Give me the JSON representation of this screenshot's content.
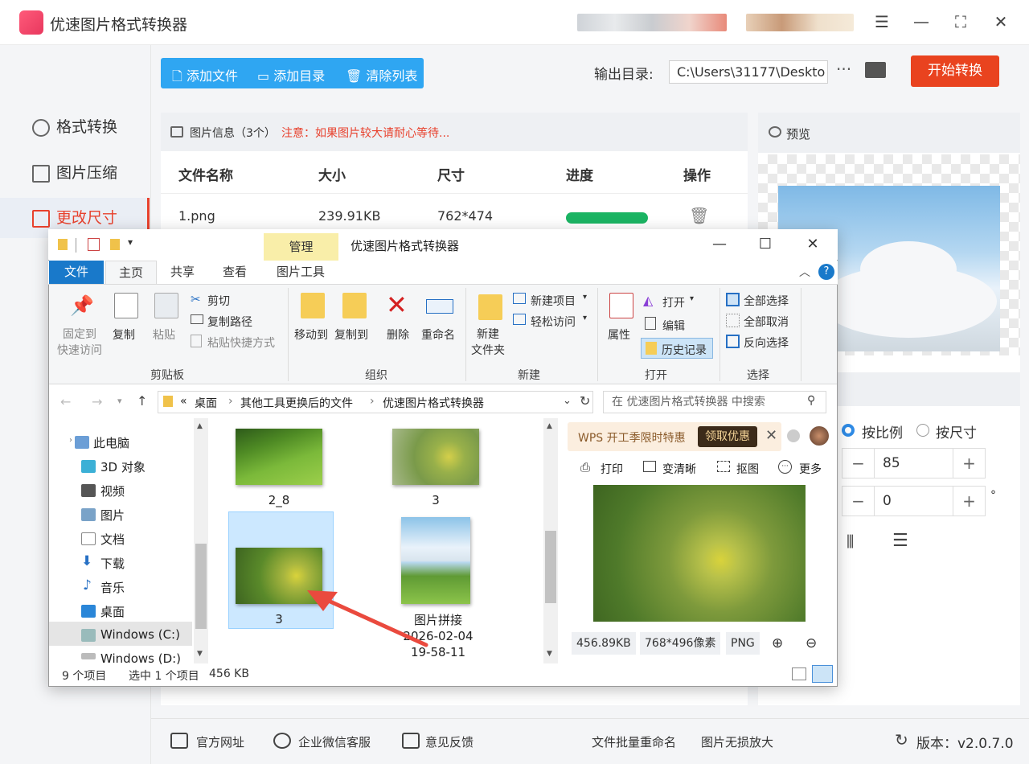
{
  "app": {
    "title": "优速图片格式转换器"
  },
  "sidebar": {
    "items": [
      {
        "label": "格式转换"
      },
      {
        "label": "图片压缩"
      },
      {
        "label": "更改尺寸"
      }
    ]
  },
  "toolbar": {
    "add_file": "添加文件",
    "add_dir": "添加目录",
    "clear_list": "清除列表"
  },
  "output": {
    "label": "输出目录:",
    "path": "C:\\Users\\31177\\Deskto",
    "more": "···",
    "start_button": "开始转换"
  },
  "info": {
    "title": "图片信息（3个）",
    "warning": "注意：如果图片较大请耐心等待..."
  },
  "table": {
    "headers": [
      "文件名称",
      "大小",
      "尺寸",
      "进度",
      "操作"
    ],
    "rows": [
      {
        "name": "1.png",
        "size": "239.91KB",
        "dims": "762*474",
        "progress": 1.0
      }
    ]
  },
  "preview": {
    "label": "预览"
  },
  "resize": {
    "by_ratio": "按比例",
    "by_size": "按尺寸",
    "ratio_value": "85",
    "angle_value": "0",
    "minus": "−",
    "plus": "+",
    "degree": "°"
  },
  "footer": {
    "official_site": "官方网址",
    "wechat_service": "企业微信客服",
    "feedback": "意见反馈",
    "batch_rename": "文件批量重命名",
    "lossless_enlarge": "图片无损放大",
    "version": "版本：v2.0.7.0"
  },
  "explorer": {
    "title": "优速图片格式转换器",
    "manage_tab": "管理",
    "tabs": [
      "文件",
      "主页",
      "共享",
      "查看",
      "图片工具"
    ],
    "ribbon": {
      "pin": "固定到\n快速访问",
      "copy": "复制",
      "paste": "粘贴",
      "cut": "剪切",
      "copy_path": "复制路径",
      "paste_shortcut": "粘贴快捷方式",
      "move_to": "移动到",
      "copy_to": "复制到",
      "delete": "删除",
      "rename": "重命名",
      "new_folder": "新建\n文件夹",
      "new_item": "新建项目",
      "easy_access": "轻松访问",
      "properties": "属性",
      "open": "打开",
      "edit": "编辑",
      "history": "历史记录",
      "select_all": "全部选择",
      "select_none": "全部取消",
      "invert_select": "反向选择",
      "groups": [
        "剪贴板",
        "组织",
        "新建",
        "打开",
        "选择"
      ]
    },
    "address": {
      "parts": [
        "桌面",
        "其他工具更换后的文件",
        "优速图片格式转换器"
      ]
    },
    "search_placeholder": "在 优速图片格式转换器 中搜索",
    "nav": [
      "此电脑",
      "3D 对象",
      "视频",
      "图片",
      "文档",
      "下载",
      "音乐",
      "桌面",
      "Windows (C:)",
      "Windows (D:)"
    ],
    "files": [
      {
        "name": "2_8"
      },
      {
        "name": "3"
      },
      {
        "name": "3"
      },
      {
        "name": "图片拼接\n2026-02-04\n19-58-11"
      }
    ],
    "preview_pane": {
      "wps_text": "WPS 开工季限时特惠",
      "wps_button": "领取优惠",
      "print": "打印",
      "sharpen": "变清晰",
      "cutout": "抠图",
      "more": "更多",
      "size": "456.89KB",
      "pixels": "768*496像素",
      "format": "PNG"
    },
    "status": {
      "count": "9 个项目",
      "selected": "选中 1 个项目",
      "selected_size": "456 KB"
    }
  }
}
